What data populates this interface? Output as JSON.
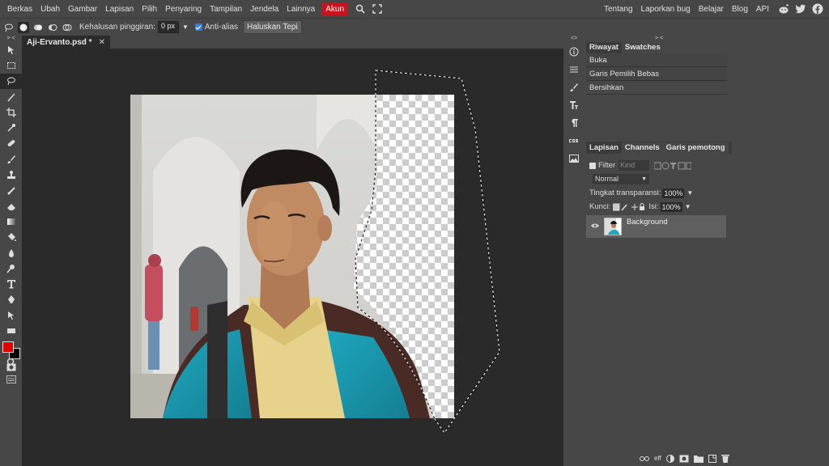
{
  "menu": {
    "items": [
      "Berkas",
      "Ubah",
      "Gambar",
      "Lapisan",
      "Pilih",
      "Penyaring",
      "Tampilan",
      "Jendela",
      "Lainnya"
    ],
    "account": "Akun",
    "right_links": [
      "Tentang",
      "Laporkan bug",
      "Belajar",
      "Blog",
      "API"
    ]
  },
  "options": {
    "smoothing_label": "Kehalusan pinggiran:",
    "smoothing_value": "0 px",
    "antialias_label": "Anti-alias",
    "refine_button": "Haluskan Tepi"
  },
  "document": {
    "tab_title": "Aji-Ervanto.psd *",
    "close": "✕"
  },
  "collapse_glyph": ">  <",
  "collapse_glyph_mid": "<>",
  "history": {
    "tabs": [
      "Riwayat",
      "Swatches"
    ],
    "items": [
      "Buka",
      "Garis Pemilih Bebas",
      "Bersihkan"
    ]
  },
  "layers": {
    "tabs": [
      "Lapisan",
      "Channels",
      "Garis pemotong"
    ],
    "filter_label": "Filter",
    "kind_placeholder": "Kind",
    "blend_mode": "Normal",
    "opacity_label": "Tingkat transparansi:",
    "opacity_value": "100%",
    "lock_label": "Kunci:",
    "fill_label": "Isi:",
    "fill_value": "100%",
    "layer_name": "Background",
    "footer_eff": "eff"
  },
  "colors": {
    "foreground": "#e00000",
    "background": "#000000",
    "accent": "#c8141e"
  }
}
